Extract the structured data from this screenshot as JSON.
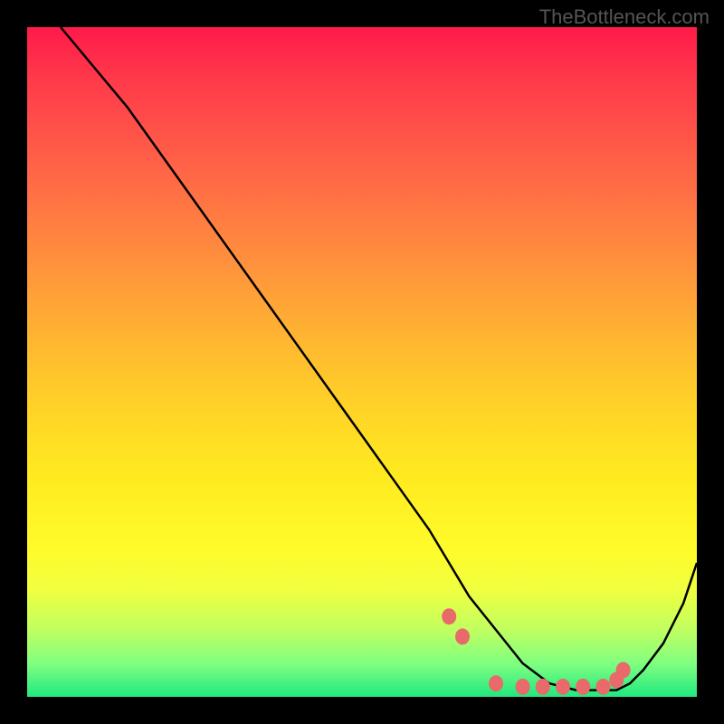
{
  "watermark": "TheBottleneck.com",
  "chart_data": {
    "type": "line",
    "title": "",
    "xlabel": "",
    "ylabel": "",
    "xlim": [
      0,
      100
    ],
    "ylim": [
      0,
      100
    ],
    "series": [
      {
        "name": "bottleneck-curve",
        "x": [
          5,
          10,
          15,
          20,
          25,
          30,
          35,
          40,
          45,
          50,
          55,
          60,
          63,
          66,
          70,
          74,
          78,
          82,
          86,
          88,
          90,
          92,
          95,
          98,
          100
        ],
        "values": [
          100,
          94,
          88,
          81,
          74,
          67,
          60,
          53,
          46,
          39,
          32,
          25,
          20,
          15,
          10,
          5,
          2,
          1,
          1,
          1,
          2,
          4,
          8,
          14,
          20
        ]
      }
    ],
    "markers": {
      "name": "highlight-points",
      "x": [
        63,
        65,
        70,
        74,
        77,
        80,
        83,
        86,
        88,
        89
      ],
      "values": [
        12,
        9,
        2,
        1.5,
        1.5,
        1.5,
        1.5,
        1.5,
        2.5,
        4
      ],
      "color": "#e86a6a"
    },
    "gradient_stops": [
      {
        "pos": 0,
        "color": "#ff1a4a"
      },
      {
        "pos": 50,
        "color": "#ffd626"
      },
      {
        "pos": 85,
        "color": "#f0ff40"
      },
      {
        "pos": 100,
        "color": "#20e880"
      }
    ]
  }
}
